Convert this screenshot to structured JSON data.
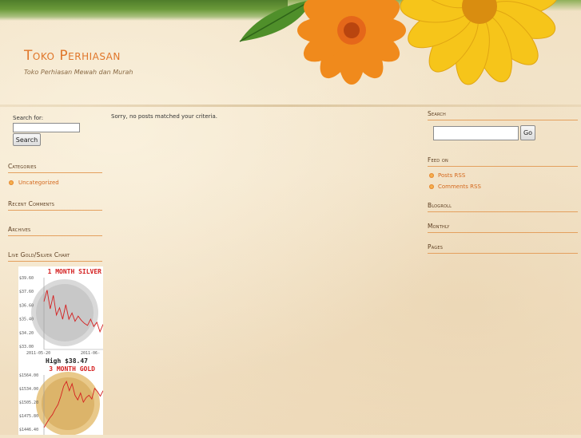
{
  "site": {
    "title": "Toko Perhiasan",
    "tagline": "Toko Perhiasan Mewah dan Murah"
  },
  "left_sidebar": {
    "search_label": "Search for:",
    "search_value": "",
    "search_button": "Search",
    "categories_title": "Categories",
    "categories": [
      "Uncategorized"
    ],
    "recent_comments_title": "Recent Comments",
    "archives_title": "Archives",
    "live_chart_title": "Live Gold/Silver Chart"
  },
  "content": {
    "message": "Sorry, no posts matched your criteria."
  },
  "right_sidebar": {
    "search_title": "Search",
    "search_value": "",
    "go_button": "Go",
    "feed_title": "Feed on",
    "feed_links": [
      "Posts RSS",
      "Comments RSS"
    ],
    "blogroll_title": "Blogroll",
    "monthly_title": "Monthly",
    "pages_title": "Pages"
  },
  "colors": {
    "accent": "#e0762a",
    "link": "#d4691e",
    "chart_line": "#d42020"
  },
  "chart_data": [
    {
      "type": "line",
      "title": "1 MONTH SILVER",
      "y_tick_labels": [
        "$39.60",
        "$37.60",
        "$36.60",
        "$35.40",
        "$34.20",
        "$33.00"
      ],
      "x_tick_labels": [
        "2011-05-20",
        "2011-06-"
      ],
      "footer": "High $38.47",
      "ylim": [
        33.0,
        39.6
      ],
      "series": [
        {
          "values": [
            37.3,
            38.4,
            36.6,
            37.9,
            36.0,
            36.7,
            35.6,
            37.0,
            35.6,
            36.2,
            35.4,
            35.9,
            35.5,
            35.2,
            35.0,
            35.6,
            34.9,
            35.3,
            34.4,
            35.1
          ]
        }
      ]
    },
    {
      "type": "line",
      "title": "3 MONTH GOLD",
      "y_tick_labels": [
        "$1564.00",
        "$1534.00",
        "$1505.20",
        "$1475.80",
        "$1446.40"
      ],
      "ylim": [
        1446.4,
        1564.0
      ],
      "series": [
        {
          "values": [
            1450,
            1460,
            1470,
            1478,
            1490,
            1500,
            1518,
            1540,
            1550,
            1530,
            1545,
            1520,
            1510,
            1525,
            1505,
            1515,
            1520,
            1512,
            1535,
            1528,
            1518,
            1530
          ]
        }
      ]
    }
  ]
}
